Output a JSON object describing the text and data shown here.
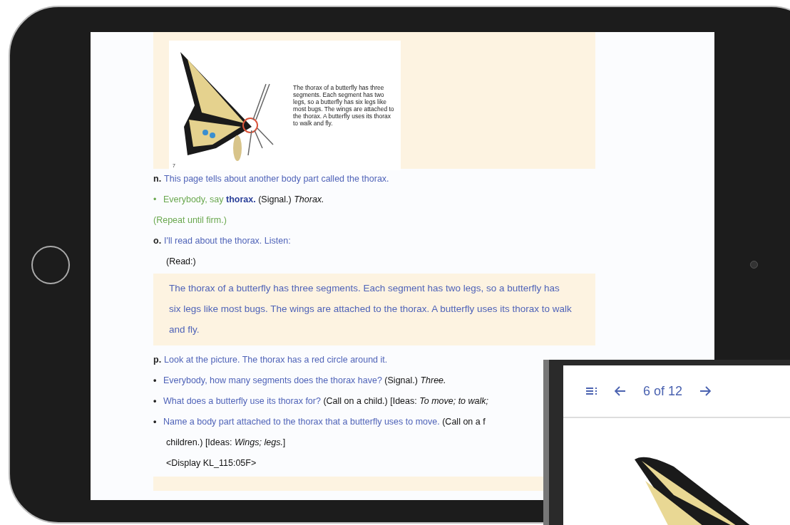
{
  "book_page": {
    "caption": "The thorax of a butterfly has three segments. Each segment has two legs, so a butterfly has six legs like most bugs. The wings are attached to the thorax. A butterfly uses its thorax to walk and fly.",
    "page_number": "7"
  },
  "lesson": [
    {
      "marker": "n.",
      "segments": [
        {
          "kind": "say",
          "text": "This page tells about another body part called the thorax."
        }
      ]
    },
    {
      "marker": "•",
      "segments": [
        {
          "kind": "green",
          "text": "Everybody, say "
        },
        {
          "kind": "term",
          "text": "thorax."
        },
        {
          "kind": "cue",
          "text": " (Signal.) "
        },
        {
          "kind": "answer",
          "text": "Thorax."
        }
      ]
    },
    {
      "segments": [
        {
          "kind": "green",
          "text": "(Repeat until firm.)"
        }
      ]
    },
    {
      "marker": "o.",
      "segments": [
        {
          "kind": "say",
          "text": "I'll read about the thorax. Listen:"
        }
      ]
    },
    {
      "segments": [
        {
          "kind": "cue",
          "text": "(Read:)"
        }
      ]
    }
  ],
  "reading": "The thorax of a butterfly has three segments. Each segment has two legs, so a butterfly has six legs like most bugs. The wings are attached to the thorax. A butterfly uses its thorax to walk and fly.",
  "lesson_2": [
    {
      "marker": "p.",
      "segments": [
        {
          "kind": "say",
          "text": "Look at the picture. The thorax has a red circle around it."
        }
      ]
    },
    {
      "marker": "•",
      "segments": [
        {
          "kind": "say",
          "text": "Everybody, how many segments does the thorax have?"
        },
        {
          "kind": "cue",
          "text": " (Signal.) "
        },
        {
          "kind": "answer",
          "text": "Three."
        }
      ]
    },
    {
      "marker": "•",
      "segments": [
        {
          "kind": "say",
          "text": "What does a butterfly use its thorax for?"
        },
        {
          "kind": "cue",
          "text": " (Call on a child.) [Ideas: *To move; to walk;*"
        }
      ]
    },
    {
      "marker": "•",
      "segments": [
        {
          "kind": "say",
          "text": "Name a body part attached to the thorax that a butterfly uses to move."
        },
        {
          "kind": "cue",
          "text": " (Call on a f"
        }
      ]
    },
    {
      "segments": [
        {
          "kind": "cue",
          "text": "children.) [Ideas: *Wings; legs.*]"
        }
      ]
    },
    {
      "segments": [
        {
          "kind": "cue",
          "text": "<Display KL_115:05F>"
        }
      ]
    }
  ],
  "second_device": {
    "page_indicator": "6 of 12"
  }
}
